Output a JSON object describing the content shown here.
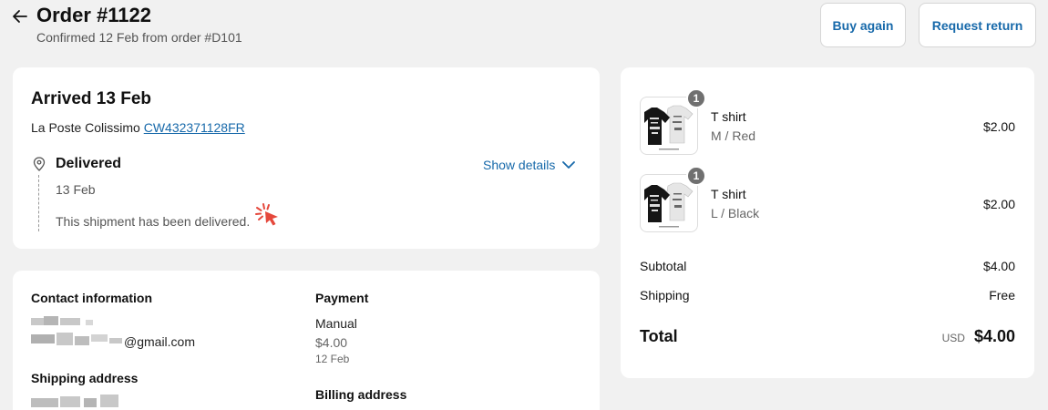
{
  "header": {
    "title": "Order #1122",
    "subtitle": "Confirmed 12 Feb from order #D101",
    "buy_again": "Buy again",
    "request_return": "Request return"
  },
  "shipment": {
    "heading": "Arrived 13 Feb",
    "carrier": "La Poste Colissimo",
    "tracking_number": "CW432371128FR",
    "status": "Delivered",
    "status_date": "13 Feb",
    "status_message": "This shipment has been delivered.",
    "show_details": "Show details"
  },
  "info": {
    "contact_heading": "Contact information",
    "email_suffix": "@gmail.com",
    "shipping_heading": "Shipping address",
    "payment_heading": "Payment",
    "payment_method": "Manual",
    "payment_amount": "$4.00",
    "payment_date": "12 Feb",
    "billing_heading": "Billing address"
  },
  "summary": {
    "items": [
      {
        "name": "T shirt",
        "variant": "M / Red",
        "price": "$2.00",
        "quantity": "1"
      },
      {
        "name": "T shirt",
        "variant": "L / Black",
        "price": "$2.00",
        "quantity": "1"
      }
    ],
    "subtotal_label": "Subtotal",
    "subtotal_value": "$4.00",
    "shipping_label": "Shipping",
    "shipping_value": "Free",
    "total_label": "Total",
    "total_currency": "USD",
    "total_value": "$4.00"
  },
  "colors": {
    "accent": "#1769aa",
    "cursor": "#e5483c"
  }
}
